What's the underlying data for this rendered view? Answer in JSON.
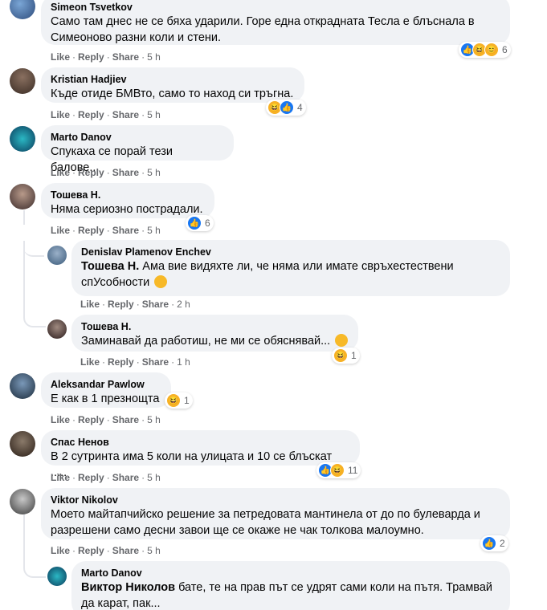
{
  "colors": {
    "bubble": "#f0f2f5",
    "meta": "#65676b",
    "like": "#1877f2",
    "haha": "#f7b125"
  },
  "action_labels": {
    "like": "Like",
    "reply": "Reply",
    "share": "Share"
  },
  "comments": [
    {
      "name": "Simeon Tsvetkov",
      "text": "Само там днес не се бяха ударили. Горе една откраднатa Тесла е блъснала в Симеоново разни коли и стени.",
      "time": "5 h",
      "reactions": "6"
    },
    {
      "name": "Kristian Hadjiev",
      "text": "Къде отиде БМВто, само то наход си тръгна.",
      "time": "5 h",
      "reactions": "4"
    },
    {
      "name": "Marto Danov",
      "text": "Спукаха се порай тези балове...",
      "time": "5 h"
    },
    {
      "name": "Тошева Н.",
      "text": "Няма сериозно пострадали.",
      "time": "5 h",
      "reactions": "6"
    },
    {
      "name": "Denislav Plamenov Enchev",
      "mention": "Тошева Н.",
      "text": " Ама вие видяхте ли, че няма или имате свръхестествени спУсобности",
      "time": "2 h"
    },
    {
      "name": "Тошева Н.",
      "text": "Заминавай да работиш, не ми се обяснявай...",
      "time": "1 h",
      "reactions": "1"
    },
    {
      "name": "Aleksandar Pawlow",
      "text": "Е как в 1 презнощта",
      "time": "5 h",
      "reactions": "1"
    },
    {
      "name": "Спас Ненов",
      "text": "В 2 сутринта има 5 коли на улицата и 10 се блъскат .....",
      "time": "5 h",
      "reactions": "11"
    },
    {
      "name": "Viktor Nikolov",
      "text": "Моето майтапчийско решение за петредовата мантинела от до по булеварда и разрешени само десни завои ще се окаже не чак толкова малоумно.",
      "time": "5 h",
      "reactions": "2"
    },
    {
      "name": "Marto Danov",
      "mention": "Виктор Николов",
      "text": " бате, те на прав път се удрят сами коли на пътя. Трамвай да карат, пак..."
    }
  ]
}
